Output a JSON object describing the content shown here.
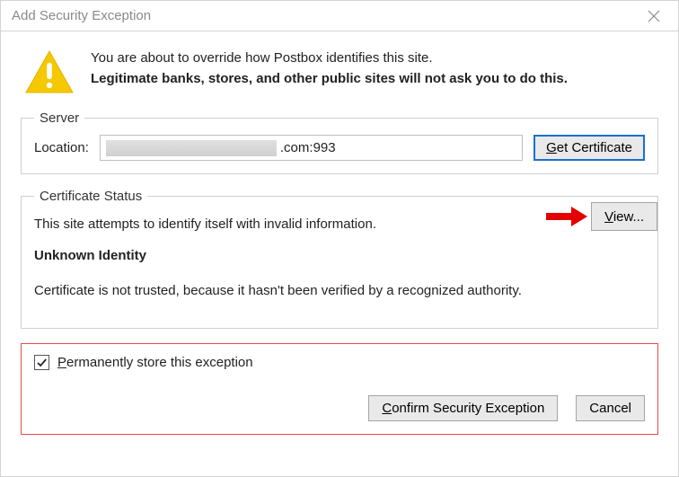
{
  "window_title": "Add Security Exception",
  "intro": {
    "line1": "You are about to override how Postbox identifies this site.",
    "line2": "Legitimate banks, stores, and other public sites will not ask you to do this."
  },
  "server": {
    "legend": "Server",
    "location_label": "Location:",
    "location_visible_suffix": ".com:993",
    "get_certificate_label_head": "G",
    "get_certificate_label_tail": "et Certificate"
  },
  "cert": {
    "legend": "Certificate Status",
    "line": "This site attempts to identify itself with invalid information.",
    "heading": "Unknown Identity",
    "detail": "Certificate is not trusted, because it hasn't been verified by a recognized authority.",
    "view_label_head": "V",
    "view_label_tail": "iew..."
  },
  "perm": {
    "checked": true,
    "label_head": "P",
    "label_tail": "ermanently store this exception"
  },
  "actions": {
    "confirm_head": "C",
    "confirm_tail": "onfirm Security Exception",
    "cancel": "Cancel"
  }
}
